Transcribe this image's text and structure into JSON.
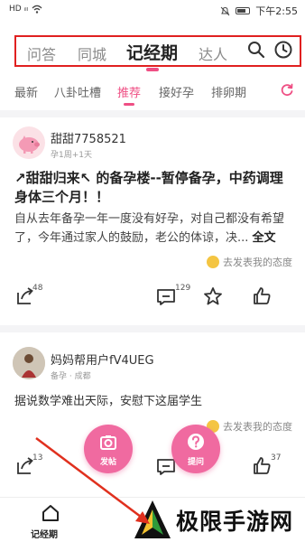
{
  "status_bar": {
    "left": "HD ᵢₗₗ",
    "time": "下午2:55"
  },
  "top_nav": {
    "tabs": [
      {
        "label": "问答",
        "active": false
      },
      {
        "label": "同城",
        "active": false
      },
      {
        "label": "记经期",
        "active": true
      },
      {
        "label": "达人",
        "active": false
      }
    ],
    "icons": [
      "search-icon",
      "clock-icon"
    ]
  },
  "categories": {
    "items": [
      {
        "label": "最新",
        "active": false
      },
      {
        "label": "八卦吐槽",
        "active": false
      },
      {
        "label": "推荐",
        "active": true
      },
      {
        "label": "接好孕",
        "active": false
      },
      {
        "label": "排卵期",
        "active": false
      }
    ],
    "refresh_icon": "refresh-icon",
    "accent": "#ef4f84"
  },
  "posts": [
    {
      "user": "甜甜7758521",
      "meta": "孕1周+1天",
      "title": "↗甜甜归来↖ 的备孕楼--暂停备孕，中药调理身体三个月！！",
      "body": "自从去年备孕一年一度没有好孕，对自己都没有希望了，今年通过家人的鼓励，老公的体谅，决...",
      "full_text_link": "全文",
      "attitude": "去发表我的态度",
      "share_count": "48",
      "comment_count": "129",
      "like_count": ""
    },
    {
      "user": "妈妈帮用户fV4UEG",
      "meta": "备孕 · 成都",
      "body": "据说数学难出天际，安慰下这届学生",
      "attitude": "去发表我的态度",
      "share_count": "13",
      "comment_count": "",
      "like_count": "37"
    }
  ],
  "fabs": [
    {
      "label": "发帖",
      "icon": "camera-icon"
    },
    {
      "label": "提问",
      "icon": "question-icon"
    }
  ],
  "bottom_nav": {
    "label": "记经期",
    "icon": "home-icon"
  },
  "watermark": {
    "text": "极限手游网"
  },
  "colors": {
    "highlight_border": "#e02020",
    "fab": "#f06aa0",
    "arrow": "#e0301e"
  }
}
